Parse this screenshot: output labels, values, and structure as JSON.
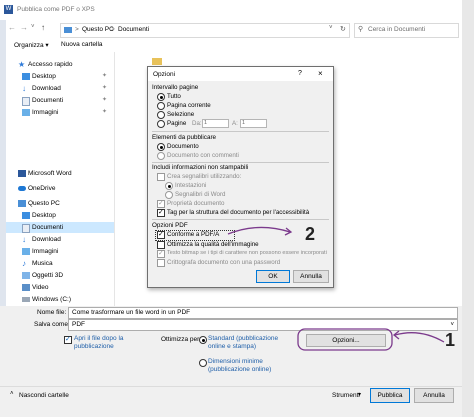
{
  "window": {
    "title": "Pubblica come PDF o XPS",
    "breadcrumb": [
      "Questo PC",
      "Documenti"
    ],
    "breadcrumb_sep": ">",
    "search_placeholder": "Cerca in Documenti"
  },
  "toolbar": {
    "organize": "Organizza ▾",
    "new_folder": "Nuova cartella"
  },
  "nav": {
    "quick_access": "Accesso rapido",
    "quick_items": [
      "Desktop",
      "Download",
      "Documenti",
      "Immagini"
    ],
    "word": "Microsoft Word",
    "onedrive": "OneDrive",
    "this_pc": "Questo PC",
    "pc_items": [
      "Desktop",
      "Documenti",
      "Download",
      "Immagini",
      "Musica",
      "Oggetti 3D",
      "Video",
      "Windows (C:)"
    ]
  },
  "form": {
    "filename_label": "Nome file:",
    "filename_value": "Come trasformare un file word in un PDF",
    "savetype_label": "Salva come:",
    "savetype_value": "PDF",
    "open_after": "Apri il file dopo la pubblicazione",
    "optimize_label": "Ottimizza per:",
    "opt_standard": "Standard (pubblicazione online e stampa)",
    "opt_minimum": "Dimensioni minime (pubblicazione online)",
    "options_button": "Opzioni...",
    "hide_folders": "Nascondi cartelle",
    "tools": "Strumenti",
    "publish": "Pubblica",
    "cancel": "Annulla"
  },
  "dialog": {
    "title": "Opzioni",
    "help": "?",
    "close": "×",
    "range_header": "Intervallo pagine",
    "range_all": "Tutto",
    "range_current": "Pagina corrente",
    "range_selection": "Selezione",
    "range_pages": "Pagine",
    "from_label": "Da:",
    "from_value": "1",
    "to_label": "A:",
    "to_value": "1",
    "publish_header": "Elementi da pubblicare",
    "pub_document": "Documento",
    "pub_document_comments": "Documento con commenti",
    "nonprint_header": "Includi informazioni non stampabili",
    "bookmarks": "Crea segnalibri utilizzando:",
    "headings": "Intestazioni",
    "word_bookmarks": "Segnalibri di Word",
    "doc_props": "Proprietà documento",
    "struct_tags": "Tag per la struttura del documento per l'accessibilità",
    "pdf_header": "Opzioni PDF",
    "pdfa": "Conforme a PDF/A",
    "optimize_image": "Ottimizza la qualità dell'immagine",
    "bitmap_text": "Testo bitmap se i tipi di carattere non possono essere incorporati",
    "encrypt": "Crittografa documento con una password",
    "ok": "OK",
    "cancel": "Annulla"
  },
  "annotations": {
    "marker_1": "1",
    "marker_2": "2",
    "color": "#7b3a8c"
  },
  "colors": {
    "selection": "#cce8ff",
    "accent": "#0078d7",
    "annotation": "#7b3a8c"
  }
}
